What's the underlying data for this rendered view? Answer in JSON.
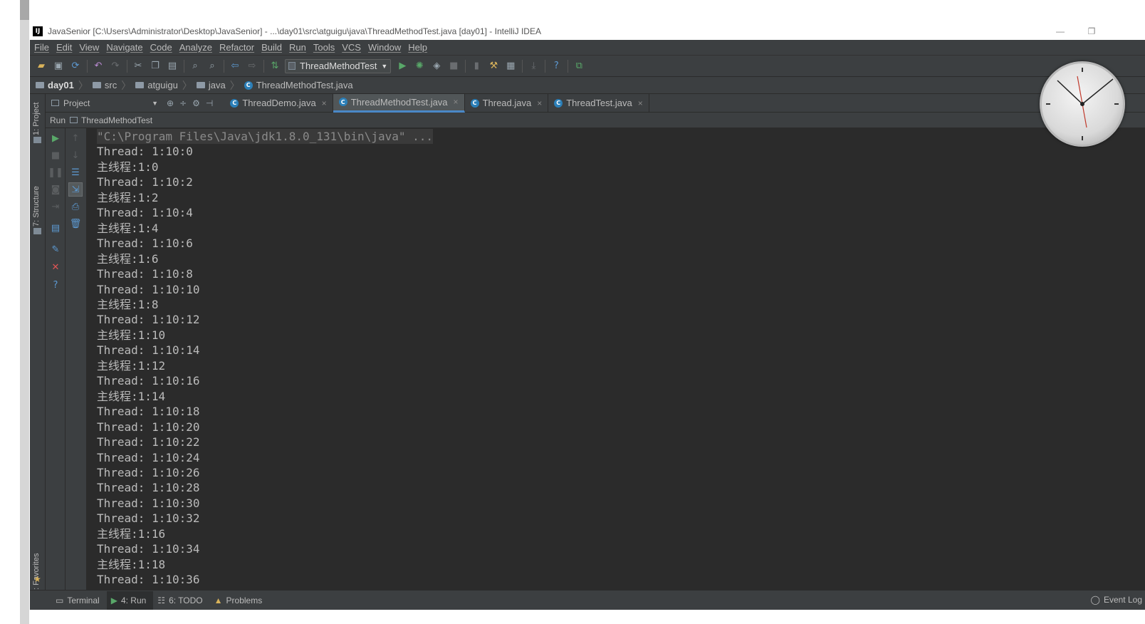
{
  "window": {
    "title": "JavaSenior [C:\\Users\\Administrator\\Desktop\\JavaSenior] - ...\\day01\\src\\atguigu\\java\\ThreadMethodTest.java [day01] - IntelliJ IDEA",
    "app_icon_text": "IJ"
  },
  "menu": [
    "File",
    "Edit",
    "View",
    "Navigate",
    "Code",
    "Analyze",
    "Refactor",
    "Build",
    "Run",
    "Tools",
    "VCS",
    "Window",
    "Help"
  ],
  "toolbar": {
    "run_config": "ThreadMethodTest"
  },
  "breadcrumb": [
    "day01",
    "src",
    "atguigu",
    "java",
    "ThreadMethodTest.java"
  ],
  "project_panel": {
    "dropdown_label": "Project"
  },
  "left_tabs": {
    "project": "1: Project",
    "structure": "7: Structure",
    "favorites": "2: Favorites"
  },
  "editor_tabs": [
    {
      "label": "ThreadDemo.java",
      "active": false
    },
    {
      "label": "ThreadMethodTest.java",
      "active": true
    },
    {
      "label": "Thread.java",
      "active": false
    },
    {
      "label": "ThreadTest.java",
      "active": false
    }
  ],
  "run_panel": {
    "label": "Run",
    "config": "ThreadMethodTest"
  },
  "console": {
    "command": "\"C:\\Program Files\\Java\\jdk1.8.0_131\\bin\\java\" ...",
    "lines": [
      "Thread: 1:10:0",
      "主线程:1:0",
      "Thread: 1:10:2",
      "主线程:1:2",
      "Thread: 1:10:4",
      "主线程:1:4",
      "Thread: 1:10:6",
      "主线程:1:6",
      "Thread: 1:10:8",
      "Thread: 1:10:10",
      "主线程:1:8",
      "Thread: 1:10:12",
      "主线程:1:10",
      "Thread: 1:10:14",
      "主线程:1:12",
      "Thread: 1:10:16",
      "主线程:1:14",
      "Thread: 1:10:18",
      "Thread: 1:10:20",
      "Thread: 1:10:22",
      "Thread: 1:10:24",
      "Thread: 1:10:26",
      "Thread: 1:10:28",
      "Thread: 1:10:30",
      "Thread: 1:10:32",
      "主线程:1:16",
      "Thread: 1:10:34",
      "主线程:1:18",
      "Thread: 1:10:36"
    ]
  },
  "statusbar": {
    "terminal": "Terminal",
    "run": "4: Run",
    "todo": "6: TODO",
    "problems": "Problems",
    "event_log": "Event Log"
  },
  "colors": {
    "ide_bg": "#3c3f41",
    "console_bg": "#2b2b2b",
    "accent": "#4a88c7"
  }
}
